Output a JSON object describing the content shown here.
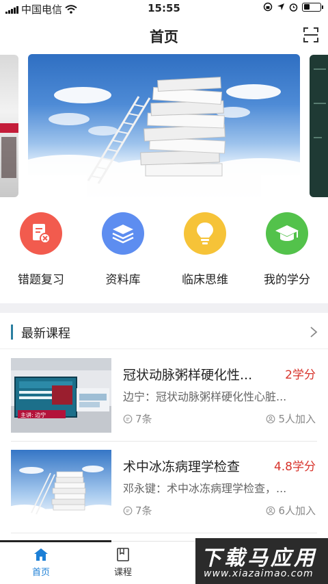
{
  "status_bar": {
    "carrier": "中国电信",
    "time": "15:55",
    "battery_level": 0.35
  },
  "nav": {
    "title": "首页",
    "scan_icon": "scan-icon"
  },
  "categories": [
    {
      "label": "错题复习",
      "icon": "wrong-question-icon",
      "color": "#f25b4e"
    },
    {
      "label": "资料库",
      "icon": "layers-icon",
      "color": "#5d8df0"
    },
    {
      "label": "临床思维",
      "icon": "lightbulb-icon",
      "color": "#f6c338"
    },
    {
      "label": "我的学分",
      "icon": "graduation-cap-icon",
      "color": "#53c24b"
    }
  ],
  "section": {
    "title": "最新课程"
  },
  "courses": [
    {
      "title": "冠状动脉粥样硬化性...",
      "credit": "2学分",
      "description": "边宁：冠状动脉粥样硬化性心脏...",
      "count": "7条",
      "joined": "5人加入",
      "thumb_caption": "主讲: 边宁"
    },
    {
      "title": "术中冰冻病理学检查",
      "credit": "4.8学分",
      "description": "邓永键：术中冰冻病理学检查，...",
      "count": "7条",
      "joined": "6人加入"
    }
  ],
  "tabbar": {
    "tabs": [
      {
        "label": "首页",
        "active": true,
        "color": "#1c7fd6"
      },
      {
        "label": "课程",
        "active": false,
        "color": "#333333"
      }
    ]
  },
  "watermark": {
    "top": "下载马应用",
    "bottom": "www.xiazaimao.com"
  },
  "colors": {
    "accent": "#1c7fd6",
    "credit": "#d8342c",
    "section_bar": "#2a7ea0"
  }
}
